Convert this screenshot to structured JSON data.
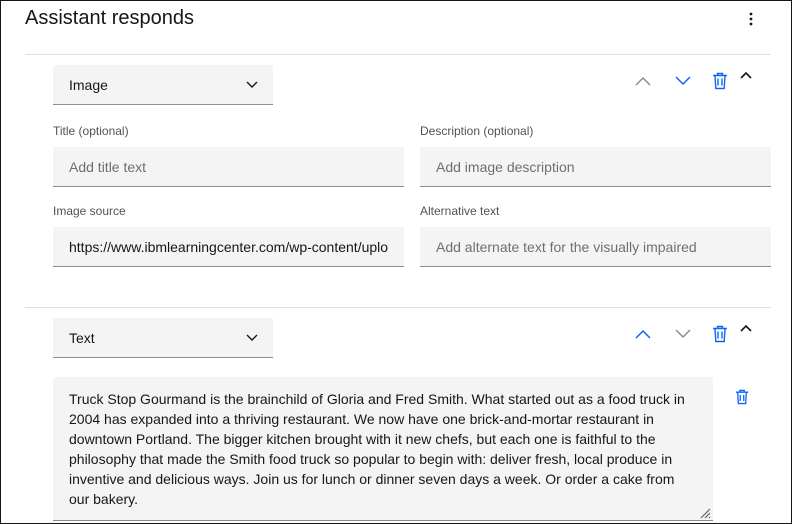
{
  "page": {
    "title": "Assistant responds",
    "overflow_menu_icon": "overflow-menu-vertical-icon"
  },
  "image_block": {
    "type_select": {
      "value": "Image",
      "icon": "chevron-down-icon"
    },
    "move_up_icon": "chevron-up-icon",
    "move_down_icon": "chevron-down-icon",
    "delete_icon": "trash-can-icon",
    "collapse_icon": "caret-up-icon",
    "title_field": {
      "label": "Title (optional)",
      "placeholder": "Add title text",
      "value": ""
    },
    "description_field": {
      "label": "Description (optional)",
      "placeholder": "Add image description",
      "value": ""
    },
    "source_field": {
      "label": "Image source",
      "placeholder": "",
      "value": "https://www.ibmlearningcenter.com/wp-content/uploads/food-truck.jpg"
    },
    "alt_field": {
      "label": "Alternative text",
      "placeholder": "Add alternate text for the visually impaired",
      "value": ""
    }
  },
  "text_block": {
    "type_select": {
      "value": "Text",
      "icon": "chevron-down-icon"
    },
    "move_up_icon": "chevron-up-icon",
    "move_down_icon": "chevron-down-icon",
    "delete_icon": "trash-can-icon",
    "collapse_icon": "caret-up-icon",
    "response_text": "Truck Stop Gourmand is the brainchild of Gloria and Fred Smith. What started out as a food truck in 2004 has expanded into a thriving restaurant. We now have one brick-and-mortar restaurant in downtown Portland. The bigger kitchen brought with it new chefs, but each one is faithful to the philosophy that made the Smith food truck so popular to begin with: deliver fresh, local produce in inventive and delicious ways. Join us for lunch or dinner seven days a week. Or order a cake from our bakery.",
    "response_delete_icon": "trash-can-icon"
  },
  "colors": {
    "active_icon": "#0f62fe",
    "disabled_icon": "#8d8d8d",
    "field_bg": "#f4f4f4"
  }
}
